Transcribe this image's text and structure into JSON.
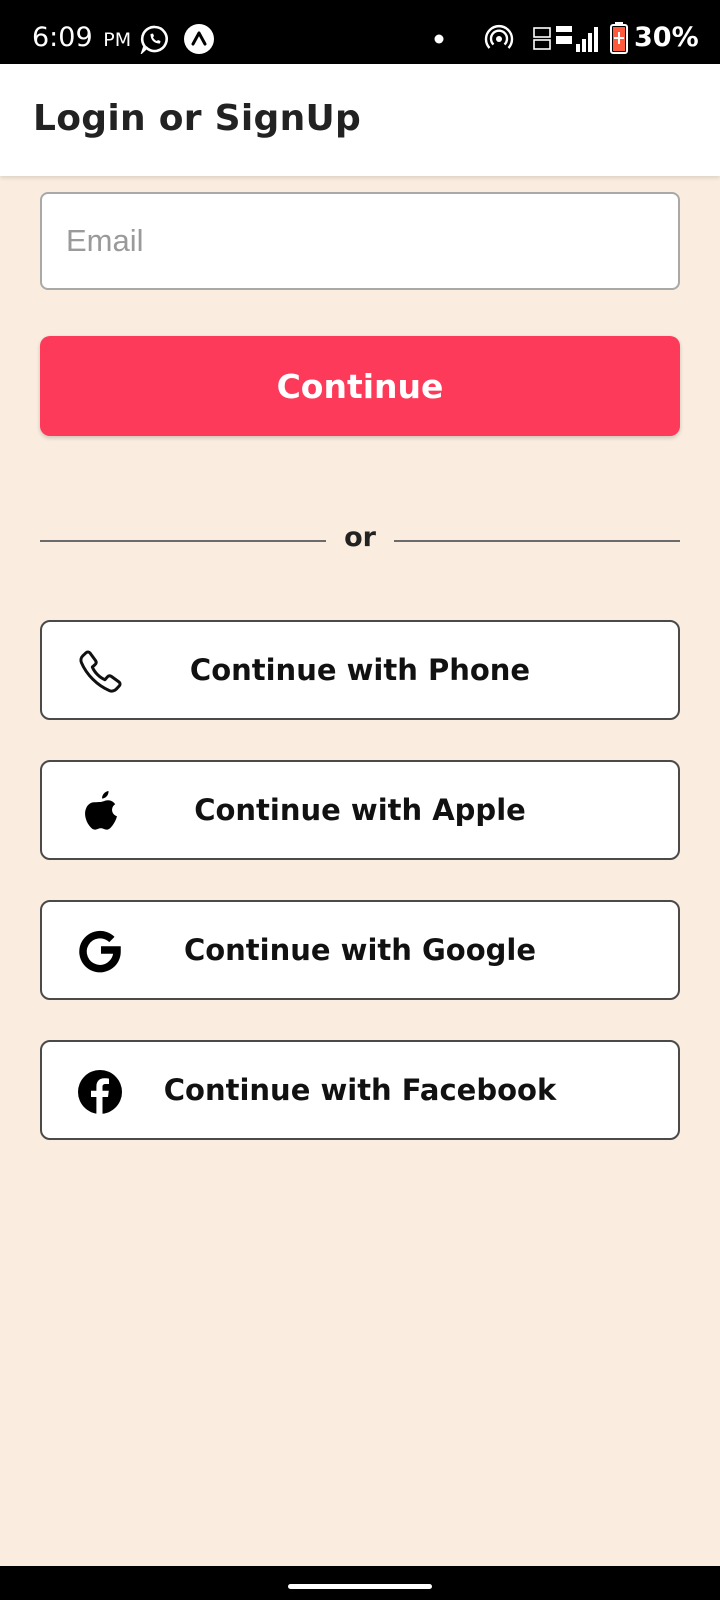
{
  "status_bar": {
    "time": "6:09",
    "ampm": "PM",
    "battery_percent": "30%",
    "icons": [
      "whatsapp-icon",
      "app-notification-icon",
      "dot-icon",
      "hotspot-icon",
      "volte-icon",
      "lte-signal-icon",
      "battery-icon"
    ]
  },
  "app_bar": {
    "title": "Login or SignUp"
  },
  "form": {
    "email_placeholder": "Email",
    "email_value": "",
    "continue_label": "Continue"
  },
  "divider": {
    "text": "or"
  },
  "social_buttons": [
    {
      "label": "Continue with Phone",
      "icon": "phone-icon"
    },
    {
      "label": "Continue with Apple",
      "icon": "apple-icon"
    },
    {
      "label": "Continue with Google",
      "icon": "google-icon"
    },
    {
      "label": "Continue with Facebook",
      "icon": "facebook-icon"
    }
  ],
  "colors": {
    "background": "#faeddf",
    "primary": "#fe3a5b",
    "status_bar": "#000000",
    "app_bar": "#ffffff",
    "battery_low": "#ff5a3c"
  }
}
